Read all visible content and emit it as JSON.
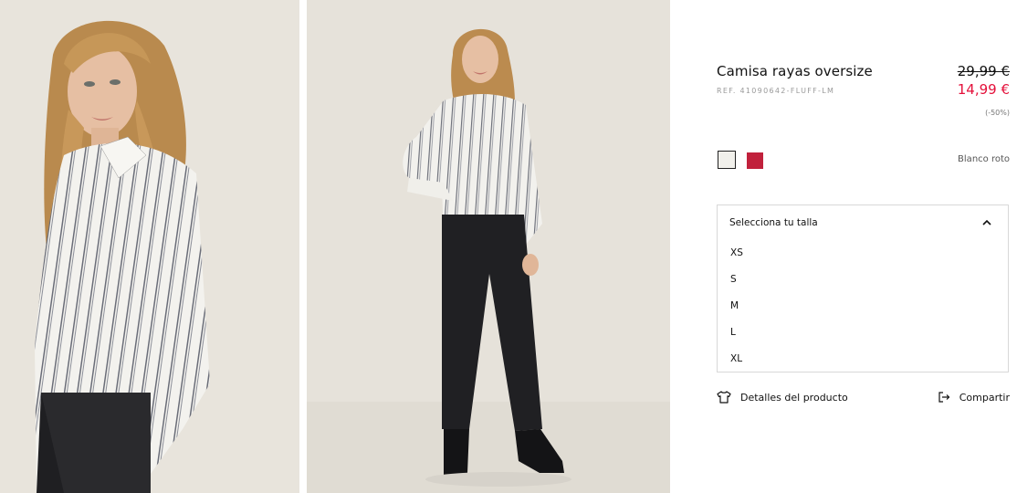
{
  "gallery": {
    "images": [
      {
        "name": "product-photo-closeup",
        "alt": ""
      },
      {
        "name": "product-photo-full",
        "alt": ""
      }
    ]
  },
  "product": {
    "title": "Camisa rayas oversize",
    "ref": "REF. 41090642-FLUFF-LM",
    "price_original": "29,99 €",
    "price_sale": "14,99 €",
    "discount": "(-50%)"
  },
  "colors": {
    "selected_label": "Blanco roto",
    "swatches": [
      {
        "name": "Blanco roto",
        "hex": "#f1f0eb"
      },
      {
        "name": "Rojo",
        "hex": "#c1213c"
      }
    ]
  },
  "size_selector": {
    "placeholder": "Selecciona tu talla",
    "options": [
      "XS",
      "S",
      "M",
      "L",
      "XL"
    ],
    "expanded": true
  },
  "actions": {
    "details_label": "Detalles del producto",
    "details_icon": "tshirt-icon",
    "share_label": "Compartir",
    "share_icon": "share-icon"
  },
  "theme": {
    "sale_color": "#e4103a",
    "text_color": "#111111"
  }
}
